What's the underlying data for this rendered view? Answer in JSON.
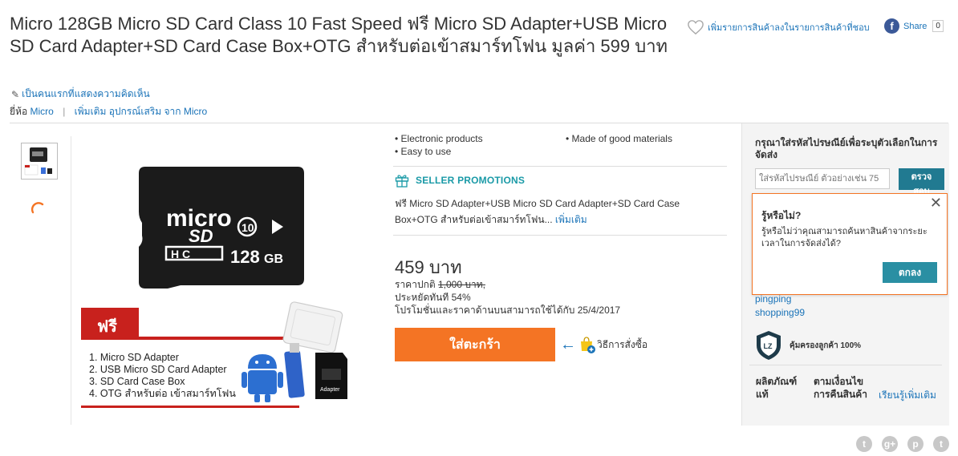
{
  "product": {
    "title": "Micro 128GB Micro SD Card Class 10 Fast Speed ฟรี Micro SD Adapter+USB Micro SD Card Adapter+SD Card Case Box+OTG สำหรับต่อเข้าสมาร์ทโฟน มูลค่า 599 บาท",
    "wishlist_label": "เพิ่มรายการสินค้าลงในรายการสินค้าที่ชอบ",
    "share_label": "Share",
    "share_count": "0",
    "review_link": "เป็นคนแรกที่แสดงความคิดเห็น",
    "brand_prefix": "ยี่ห้อ",
    "brand_name": "Micro",
    "brand_more": "เพิ่มเติม อุปกรณ์เสริม จาก Micro"
  },
  "image": {
    "card_brand": "micro",
    "card_class": "10",
    "card_size": "128",
    "card_unit": "GB",
    "free_label": "ฟรี",
    "free_items": [
      "1. Micro SD Adapter",
      "2. USB Micro SD Card Adapter",
      "3. SD Card Case Box",
      "4. OTG สำหรับต่อ เข้าสมาร์ทโฟน"
    ],
    "adapter_label": "Adapter"
  },
  "highlights": [
    "Electronic products",
    "Made of good materials",
    "Easy to use"
  ],
  "promotions": {
    "heading": "SELLER PROMOTIONS",
    "text": "ฟรี Micro SD Adapter+USB Micro SD Card Adapter+SD Card Case Box+OTG สำหรับต่อเข้าสมาร์ทโฟน...",
    "more_link": "เพิ่มเติม"
  },
  "pricing": {
    "price": "459 บาท",
    "regular_label": "ราคาปกติ",
    "regular_price": "1,000 บาท,",
    "saving_label": "ประหยัดทันที",
    "saving_value": "54%",
    "valid_text": "โปรโมชั่นและราคาด้านบนสามารถใช้ได้กับ 25/4/2017"
  },
  "actions": {
    "add_to_cart": "ใส่ตะกร้า",
    "how_to_order": "วิธีการสั่งซื้อ"
  },
  "delivery": {
    "heading": "กรุณาใส่รหัสไปรษณีย์เพื่อระบุตัวเลือกในการจัดส่ง",
    "zip_placeholder": "ใส่รหัสไปรษณีย์ ตัวอย่างเช่น 75",
    "check_button": "ตรวจสอบ"
  },
  "tooltip": {
    "heading": "รู้หรือไม่?",
    "text": "รู้หรือไม่ว่าคุณสามารถค้นหาสินค้าจากระยะเวลาในการจัดส่งได้?",
    "ok_button": "ตกลง",
    "close": "✕"
  },
  "seller": {
    "name_line1": "pingping",
    "name_line2": "shopping99",
    "guarantee": "คุ้มครองลูกค้า 100%"
  },
  "returns": {
    "col1": "ผลิตภัณฑ์แท้",
    "col2": "ตามเงื่อนไขการคืนสินค้า",
    "learn_more": "เรียนรู้เพิ่มเติม"
  },
  "social_icons": [
    "twitter-icon",
    "googleplus-icon",
    "pinterest-icon",
    "tumblr-icon"
  ],
  "colors": {
    "accent_orange": "#f47424",
    "teal": "#217a91",
    "link_blue": "#1a73b8"
  }
}
